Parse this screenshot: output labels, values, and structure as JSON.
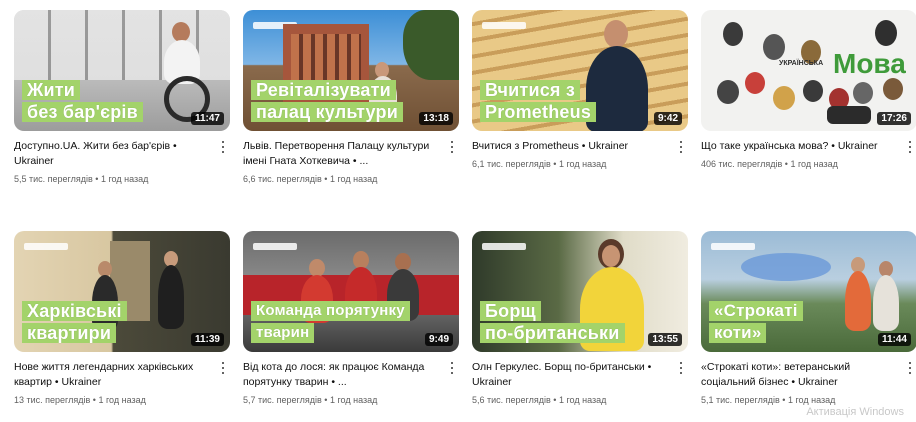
{
  "videos": [
    {
      "caption": [
        "Жити",
        "без бар'єрів"
      ],
      "duration": "11:47",
      "title": "Доступно.UA. Жити без бар'єрів • Ukrainer",
      "stats": "5,5 тис. переглядів • 1 год назад"
    },
    {
      "caption": [
        "Ревіталізувати",
        "палац культури"
      ],
      "duration": "13:18",
      "title": "Львів. Перетворення Палацу культури імені Гната Хоткевича • ...",
      "stats": "6,6 тис. переглядів • 1 год назад"
    },
    {
      "caption": [
        "Вчитися з",
        "Prometheus"
      ],
      "duration": "9:42",
      "title": "Вчитися з Prometheus • Ukrainer",
      "stats": "6,1 тис. переглядів • 1 год назад"
    },
    {
      "caption": [],
      "duration": "17:26",
      "title": "Що таке українська мова? • Ukrainer",
      "stats": "406 тис. переглядів • 1 год назад",
      "thumb_text": {
        "big": "Мова",
        "small": "УКРАЇНСЬКА"
      }
    },
    {
      "caption": [
        "Харківські",
        "квартири"
      ],
      "duration": "11:39",
      "title": "Нове життя легендарних харківських квартир • Ukrainer",
      "stats": "13 тис. переглядів • 1 год назад"
    },
    {
      "caption": [
        "Команда порятунку",
        "тварин"
      ],
      "duration": "9:49",
      "title": "Від кота до лося: як працює Команда порятунку тварин • ...",
      "stats": "5,7 тис. переглядів • 1 год назад"
    },
    {
      "caption": [
        "Борщ",
        "по-британськи"
      ],
      "duration": "13:55",
      "title": "Олн Геркулес. Борщ по-британськи • Ukrainer",
      "stats": "5,6 тис. переглядів • 1 год назад"
    },
    {
      "caption": [
        "«Строкаті",
        "коти»"
      ],
      "duration": "11:44",
      "title": "«Строкаті коти»: ветеранський соціальний бізнес • Ukrainer",
      "stats": "5,1 тис. переглядів • 1 год назад"
    }
  ],
  "watermark": "Активація Windows",
  "colors": {
    "caption_bg": "#a3d36a",
    "duration_bg": "#000000",
    "title": "#0f0f0f",
    "stats": "#606060"
  }
}
